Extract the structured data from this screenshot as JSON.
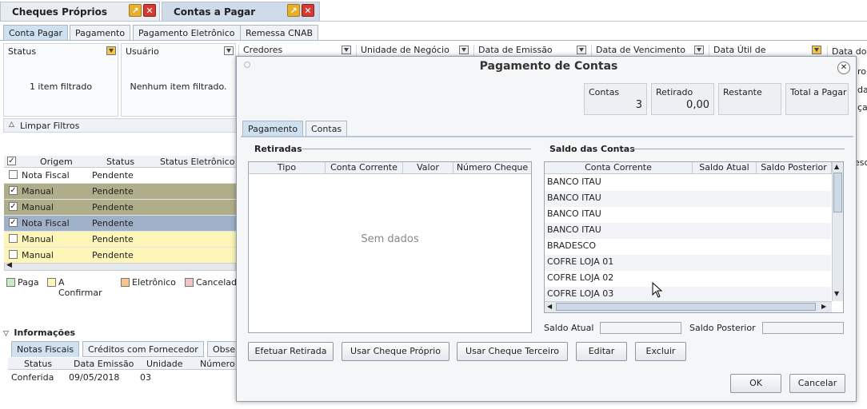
{
  "doc_tabs": [
    {
      "label": "Cheques Próprios"
    },
    {
      "label": "Contas a Pagar"
    }
  ],
  "sub_tabs": [
    "Conta Pagar",
    "Pagamento",
    "Pagamento Eletrônico",
    "Remessa CNAB"
  ],
  "filters": [
    {
      "title": "Status",
      "text": "1 item filtrado"
    },
    {
      "title": "Usuário",
      "text": "Nenhum item filtrado."
    },
    {
      "title": "Credores"
    },
    {
      "title": "Unidade de Negócio"
    },
    {
      "title": "Data de Emissão"
    },
    {
      "title": "Data de Vencimento"
    },
    {
      "title": "Data Útil de"
    },
    {
      "title": "Data do"
    }
  ],
  "clear_filters": "Limpar Filtros",
  "grid": {
    "headers": [
      "Origem",
      "Status",
      "Status Eletrônico"
    ],
    "rows": [
      {
        "checked": false,
        "origem": "Nota Fiscal",
        "status": "Pendente",
        "color": "#ffffff"
      },
      {
        "checked": true,
        "origem": "Manual",
        "status": "Pendente",
        "color": "#b0ae8a"
      },
      {
        "checked": true,
        "origem": "Manual",
        "status": "Pendente",
        "color": "#b0ae8a"
      },
      {
        "checked": true,
        "origem": "Nota Fiscal",
        "status": "Pendente",
        "color": "#9fb1c8"
      },
      {
        "checked": false,
        "origem": "Manual",
        "status": "Pendente",
        "color": "#fdf6b8"
      },
      {
        "checked": false,
        "origem": "Manual",
        "status": "Pendente",
        "color": "#fdf6b8"
      }
    ]
  },
  "legend": [
    {
      "label": "Paga",
      "color": "#c9ecc4"
    },
    {
      "label": "A Confirmar",
      "color": "#fdf6b8"
    },
    {
      "label": "Eletrônico",
      "color": "#f6c58e"
    },
    {
      "label": "Cancelad",
      "color": "#f4c4c4"
    }
  ],
  "info": {
    "title": "Informações",
    "tabs": [
      "Notas Fiscais",
      "Créditos com Fornecedor",
      "Obse"
    ],
    "headers": [
      "Status",
      "Data Emissão",
      "Unidade",
      "Número"
    ],
    "row": [
      "Conferida",
      "09/05/2018",
      "03",
      ""
    ]
  },
  "dialog": {
    "title": "Pagamento de Contas",
    "cards": [
      {
        "label": "Contas",
        "value": "3"
      },
      {
        "label": "Retirado",
        "value": "0,00"
      },
      {
        "label": "Restante",
        "value": ""
      },
      {
        "label": "Total a Pagar",
        "value": ""
      }
    ],
    "tabs": [
      "Pagamento",
      "Contas"
    ],
    "retiradas": {
      "title": "Retiradas",
      "headers": [
        "Tipo",
        "Conta Corrente",
        "Valor",
        "Número Cheque"
      ],
      "empty": "Sem dados"
    },
    "saldo": {
      "title": "Saldo das Contas",
      "headers": [
        "Conta Corrente",
        "Saldo Atual",
        "Saldo Posterior"
      ],
      "rows": [
        "BANCO ITAU",
        "BANCO ITAU",
        "BANCO ITAU",
        "BANCO ITAU",
        "BRADESCO",
        "COFRE LOJA 01",
        "COFRE LOJA 02",
        "COFRE LOJA 03"
      ]
    },
    "saldo_atual_label": "Saldo Atual",
    "saldo_posterior_label": "Saldo Posterior",
    "buttons": [
      "Efetuar Retirada",
      "Usar Cheque Próprio",
      "Usar Cheque Terceiro",
      "Editar",
      "Excluir"
    ],
    "ok": "OK",
    "cancel": "Cancelar"
  },
  "right_edge": [
    "ro",
    "da",
    "ça",
    "esc"
  ]
}
